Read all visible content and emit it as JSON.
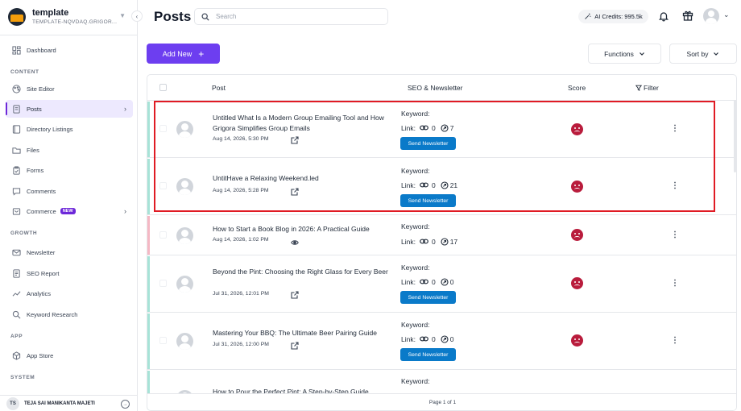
{
  "sidebar": {
    "brand": {
      "name": "template",
      "subtitle": "TEMPLATE-NQVDAQ.GRIGOR..."
    },
    "sections": {
      "content": "CONTENT",
      "growth": "GROWTH",
      "app": "APP",
      "system": "SYSTEM"
    },
    "items": {
      "dashboard": "Dashboard",
      "site_editor": "Site Editor",
      "posts": "Posts",
      "directory": "Directory Listings",
      "files": "Files",
      "forms": "Forms",
      "comments": "Comments",
      "commerce": "Commerce",
      "commerce_badge": "NEW",
      "newsletter": "Newsletter",
      "seo_report": "SEO Report",
      "analytics": "Analytics",
      "keyword_research": "Keyword Research",
      "app_store": "App Store"
    },
    "user": {
      "initials": "TS",
      "name": "TEJA SAI MANIKANTA MAJETI"
    }
  },
  "header": {
    "title": "Posts",
    "search_placeholder": "Search",
    "ai_credits": "AI Credits: 995.5k"
  },
  "toolbar": {
    "add_new": "Add New",
    "functions": "Functions",
    "sort_by": "Sort by"
  },
  "table": {
    "columns": {
      "post": "Post",
      "seo": "SEO & Newsletter",
      "score": "Score",
      "filter": "Filter"
    },
    "keyword_label": "Keyword:",
    "link_label": "Link:",
    "newsletter_button": "Send Newsletter",
    "rows": [
      {
        "title": "Untitled What Is a Modern Group Emailing Tool and How Grigora Simplifies Group Emails",
        "date": "Aug 14, 2026, 5:30 PM",
        "links": "0",
        "refs": "7",
        "accent": "#a7e3d7"
      },
      {
        "title": "UntitHave a Relaxing Weekend.led",
        "date": "Aug 14, 2026, 5:28 PM",
        "links": "0",
        "refs": "21",
        "accent": "#a7e3d7"
      },
      {
        "title": "How to Start a Book Blog in 2026: A Practical Guide",
        "date": "Aug 14, 2026, 1:02 PM",
        "links": "0",
        "refs": "17",
        "accent": "#f5b8c4"
      },
      {
        "title": "Beyond the Pint: Choosing the Right Glass for Every Beer",
        "date": "Jul 31, 2026, 12:01 PM",
        "links": "0",
        "refs": "0",
        "accent": "#a7e3d7"
      },
      {
        "title": "Mastering Your BBQ: The Ultimate Beer Pairing Guide",
        "date": "Jul 31, 2026, 12:00 PM",
        "links": "0",
        "refs": "0",
        "accent": "#a7e3d7"
      },
      {
        "title": "How to Pour the Perfect Pint: A Step-by-Step Guide",
        "date": "",
        "links": "",
        "refs": "",
        "accent": "#a7e3d7"
      }
    ],
    "pagination": "Page 1 of 1"
  }
}
